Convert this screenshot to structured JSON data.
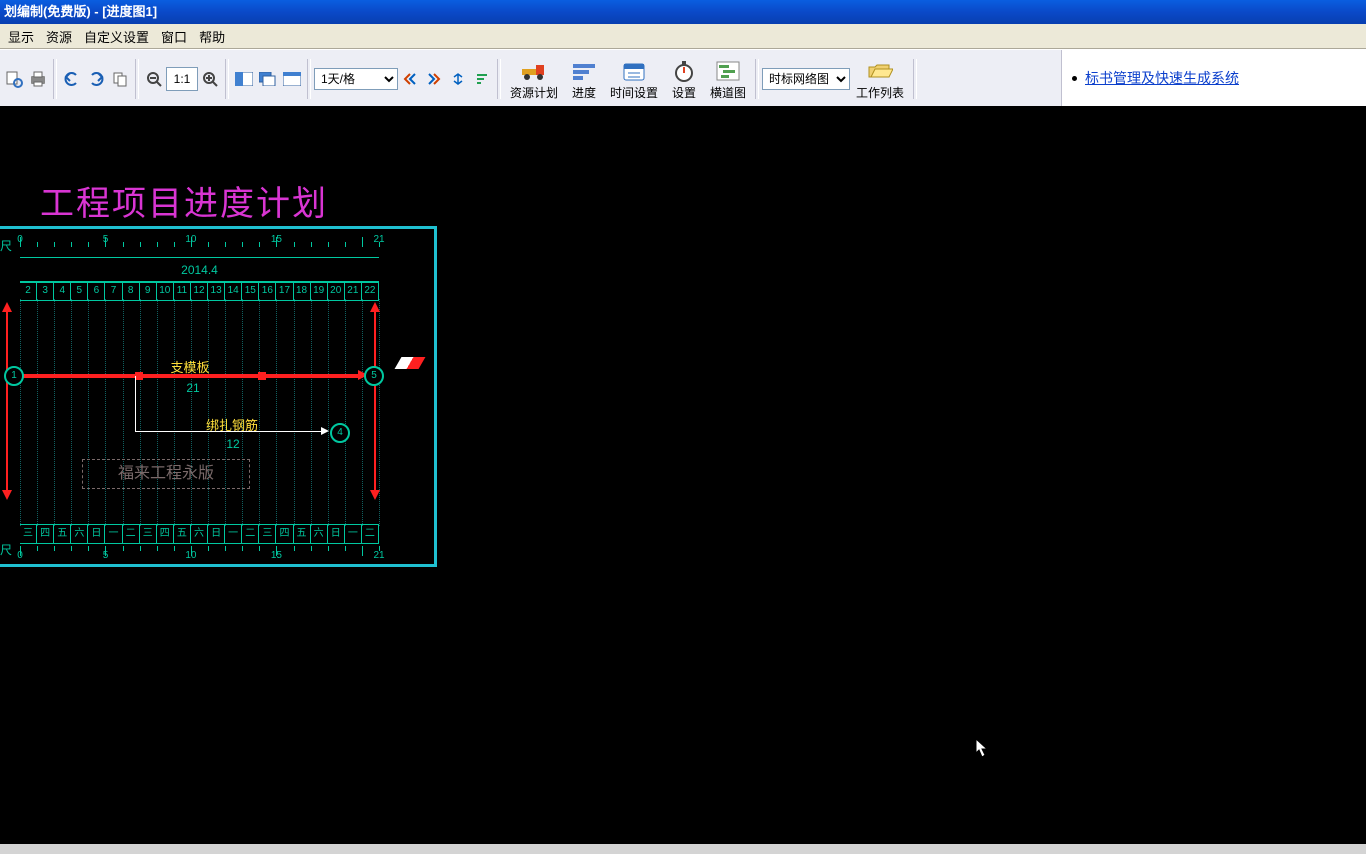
{
  "title_bar": "划编制(免费版) - [进度图1]",
  "menu": [
    "显示",
    "资源",
    "自定义设置",
    "窗口",
    "帮助"
  ],
  "toolbar": {
    "scale_value": "1:1",
    "time_unit": "1天/格",
    "view_combo": "时标网络图",
    "resource_plan": "资源计划",
    "progress": "进度",
    "time_settings": "时间设置",
    "settings": "设置",
    "gantt": "横道图",
    "work_list": "工作列表"
  },
  "link": "标书管理及快速生成系统",
  "plan_title": "工程项目进度计划",
  "chart_data": {
    "type": "network-schedule",
    "ruler_unit_label": "尺",
    "ruler_major_ticks": [
      0,
      5,
      10,
      15,
      21
    ],
    "month_label": "2014.4",
    "day_numbers": [
      2,
      3,
      4,
      5,
      6,
      7,
      8,
      9,
      10,
      11,
      12,
      13,
      14,
      15,
      16,
      17,
      18,
      19,
      20,
      21,
      22
    ],
    "weekday_cells": [
      "三",
      "四",
      "五",
      "六",
      "日",
      "一",
      "二",
      "三",
      "四",
      "五",
      "六",
      "日",
      "一",
      "二",
      "三",
      "四",
      "五",
      "六",
      "日",
      "一",
      "二"
    ],
    "tasks": [
      {
        "name": "支模板",
        "duration": 21,
        "from_node": 1,
        "to_node": 5,
        "critical": true
      },
      {
        "name": "绑扎钢筋",
        "duration": 12,
        "from_node": null,
        "to_node": 4,
        "critical": false
      }
    ],
    "nodes": [
      1,
      4,
      5
    ],
    "watermark": "福来工程永版"
  }
}
